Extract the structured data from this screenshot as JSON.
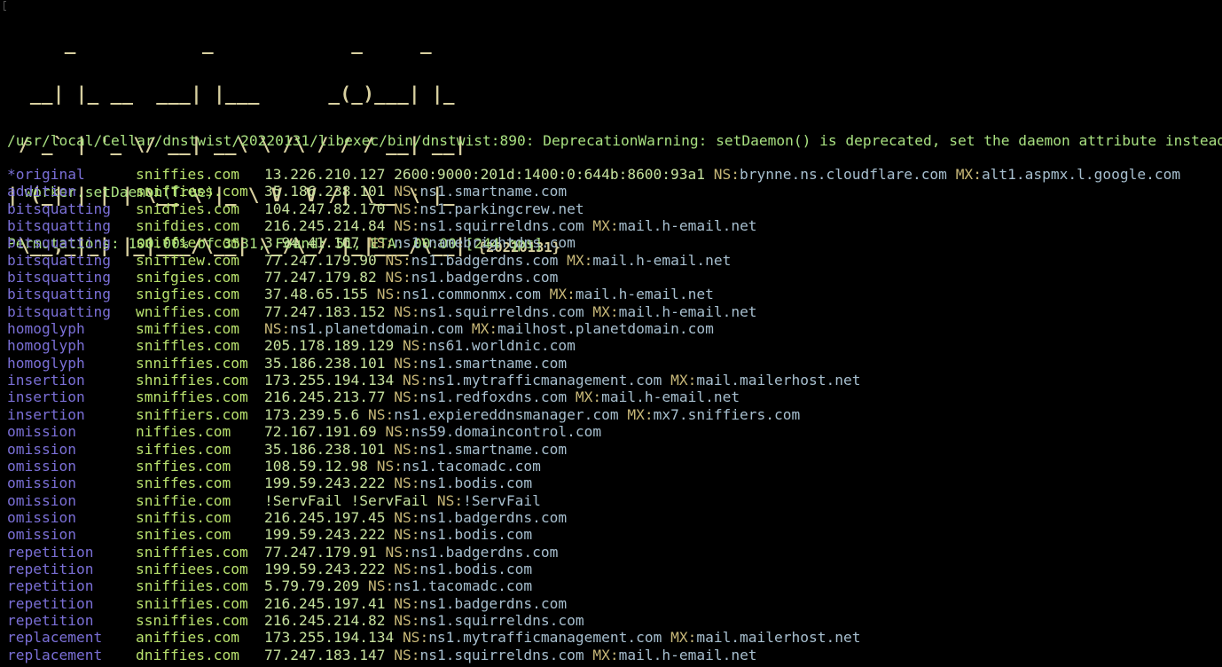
{
  "banner": {
    "ascii_lines": [
      "     _           _            _     _   ",
      "  __| |_ __  ___| |___      _(_)___| |_ ",
      " / _` | '_ \\/ __| __\\ \\ /\\ / / / __| __|",
      "| (_| | | | \\__ \\ |_ \\ V  V /| \\__ \\ |_ ",
      " \\__,_|_| |_|___/\\__| \\_/\\_/ |_|___/\\__| "
    ],
    "version": "{20220131}"
  },
  "header": {
    "warning_line": "/usr/local/Cellar/dnstwist/20220131/libexec/bin/dnstwist:890: DeprecationWarning: setDaemon() is deprecated, set the daemon attribute instead",
    "warning_code": "  worker.setDaemon(True)",
    "progress_line": "Permutations: 100.00% of 3531, Found: 51, ETA: 00:00 [244 qps]",
    "progress": {
      "percent": 100.0,
      "total": 3531,
      "found": 51,
      "eta": "00:00",
      "rate": "244 qps"
    }
  },
  "labels": {
    "ns": "NS",
    "mx": "MX"
  },
  "results": [
    {
      "fuzzer": "*original",
      "domain": "sniffies.com",
      "ip": "13.226.210.127 2600:9000:201d:1400:0:644b:8600:93a1",
      "ns": "brynne.ns.cloudflare.com",
      "mx": "alt1.aspmx.l.google.com"
    },
    {
      "fuzzer": "addition",
      "domain": "sniffiess.com",
      "ip": "35.186.238.101",
      "ns": "ns1.smartname.com",
      "mx": ""
    },
    {
      "fuzzer": "bitsquatting",
      "domain": "snidfies.com",
      "ip": "104.247.82.170",
      "ns": "ns1.parkingcrew.net",
      "mx": ""
    },
    {
      "fuzzer": "bitsquatting",
      "domain": "snifdies.com",
      "ip": "216.245.214.84",
      "ns": "ns1.squirreldns.com",
      "mx": "mail.h-email.net"
    },
    {
      "fuzzer": "bitsquatting",
      "domain": "sniffier.com",
      "ip": "3.94.41.167",
      "ns": "ns1.namebrightdns.com",
      "mx": ""
    },
    {
      "fuzzer": "bitsquatting",
      "domain": "sniffiew.com",
      "ip": "77.247.179.90",
      "ns": "ns1.badgerdns.com",
      "mx": "mail.h-email.net"
    },
    {
      "fuzzer": "bitsquatting",
      "domain": "snifgies.com",
      "ip": "77.247.179.82",
      "ns": "ns1.badgerdns.com",
      "mx": ""
    },
    {
      "fuzzer": "bitsquatting",
      "domain": "snigfies.com",
      "ip": "37.48.65.155",
      "ns": "ns1.commonmx.com",
      "mx": "mail.h-email.net"
    },
    {
      "fuzzer": "bitsquatting",
      "domain": "wniffies.com",
      "ip": "77.247.183.152",
      "ns": "ns1.squirreldns.com",
      "mx": "mail.h-email.net"
    },
    {
      "fuzzer": "homoglyph",
      "domain": "smiffies.com",
      "ip": "",
      "ns": "ns1.planetdomain.com",
      "mx": "mailhost.planetdomain.com"
    },
    {
      "fuzzer": "homoglyph",
      "domain": "sniffles.com",
      "ip": "205.178.189.129",
      "ns": "ns61.worldnic.com",
      "mx": ""
    },
    {
      "fuzzer": "homoglyph",
      "domain": "snniffies.com",
      "ip": "35.186.238.101",
      "ns": "ns1.smartname.com",
      "mx": ""
    },
    {
      "fuzzer": "insertion",
      "domain": "shniffies.com",
      "ip": "173.255.194.134",
      "ns": "ns1.mytrafficmanagement.com",
      "mx": "mail.mailerhost.net"
    },
    {
      "fuzzer": "insertion",
      "domain": "smniffies.com",
      "ip": "216.245.213.77",
      "ns": "ns1.redfoxdns.com",
      "mx": "mail.h-email.net"
    },
    {
      "fuzzer": "insertion",
      "domain": "sniffiers.com",
      "ip": "173.239.5.6",
      "ns": "ns1.expiereddnsmanager.com",
      "mx": "mx7.sniffiers.com"
    },
    {
      "fuzzer": "omission",
      "domain": "niffies.com",
      "ip": "72.167.191.69",
      "ns": "ns59.domaincontrol.com",
      "mx": ""
    },
    {
      "fuzzer": "omission",
      "domain": "siffies.com",
      "ip": "35.186.238.101",
      "ns": "ns1.smartname.com",
      "mx": ""
    },
    {
      "fuzzer": "omission",
      "domain": "snffies.com",
      "ip": "108.59.12.98",
      "ns": "ns1.tacomadc.com",
      "mx": ""
    },
    {
      "fuzzer": "omission",
      "domain": "sniffes.com",
      "ip": "199.59.243.222",
      "ns": "ns1.bodis.com",
      "mx": ""
    },
    {
      "fuzzer": "omission",
      "domain": "sniffie.com",
      "ip": "!ServFail !ServFail",
      "ns": "!ServFail",
      "mx": ""
    },
    {
      "fuzzer": "omission",
      "domain": "sniffis.com",
      "ip": "216.245.197.45",
      "ns": "ns1.badgerdns.com",
      "mx": ""
    },
    {
      "fuzzer": "omission",
      "domain": "snifies.com",
      "ip": "199.59.243.222",
      "ns": "ns1.bodis.com",
      "mx": ""
    },
    {
      "fuzzer": "repetition",
      "domain": "snifffies.com",
      "ip": "77.247.179.91",
      "ns": "ns1.badgerdns.com",
      "mx": ""
    },
    {
      "fuzzer": "repetition",
      "domain": "sniffiees.com",
      "ip": "199.59.243.222",
      "ns": "ns1.bodis.com",
      "mx": ""
    },
    {
      "fuzzer": "repetition",
      "domain": "sniffiies.com",
      "ip": "5.79.79.209",
      "ns": "ns1.tacomadc.com",
      "mx": ""
    },
    {
      "fuzzer": "repetition",
      "domain": "sniiffies.com",
      "ip": "216.245.197.41",
      "ns": "ns1.badgerdns.com",
      "mx": ""
    },
    {
      "fuzzer": "repetition",
      "domain": "ssniffies.com",
      "ip": "216.245.214.82",
      "ns": "ns1.squirreldns.com",
      "mx": ""
    },
    {
      "fuzzer": "replacement",
      "domain": "aniffies.com",
      "ip": "173.255.194.134",
      "ns": "ns1.mytrafficmanagement.com",
      "mx": "mail.mailerhost.net"
    },
    {
      "fuzzer": "replacement",
      "domain": "dniffies.com",
      "ip": "77.247.183.147",
      "ns": "ns1.squirreldns.com",
      "mx": "mail.h-email.net"
    }
  ],
  "colors": {
    "background": "#000000",
    "header_text": "#a8e080",
    "banner_text": "#d8d0a0",
    "fuzzer": "#7a6fd6",
    "domain": "#b9e26e",
    "ip": "#c6e29e",
    "record_label": "#c8b878",
    "record_value": "#a7bfcf"
  }
}
